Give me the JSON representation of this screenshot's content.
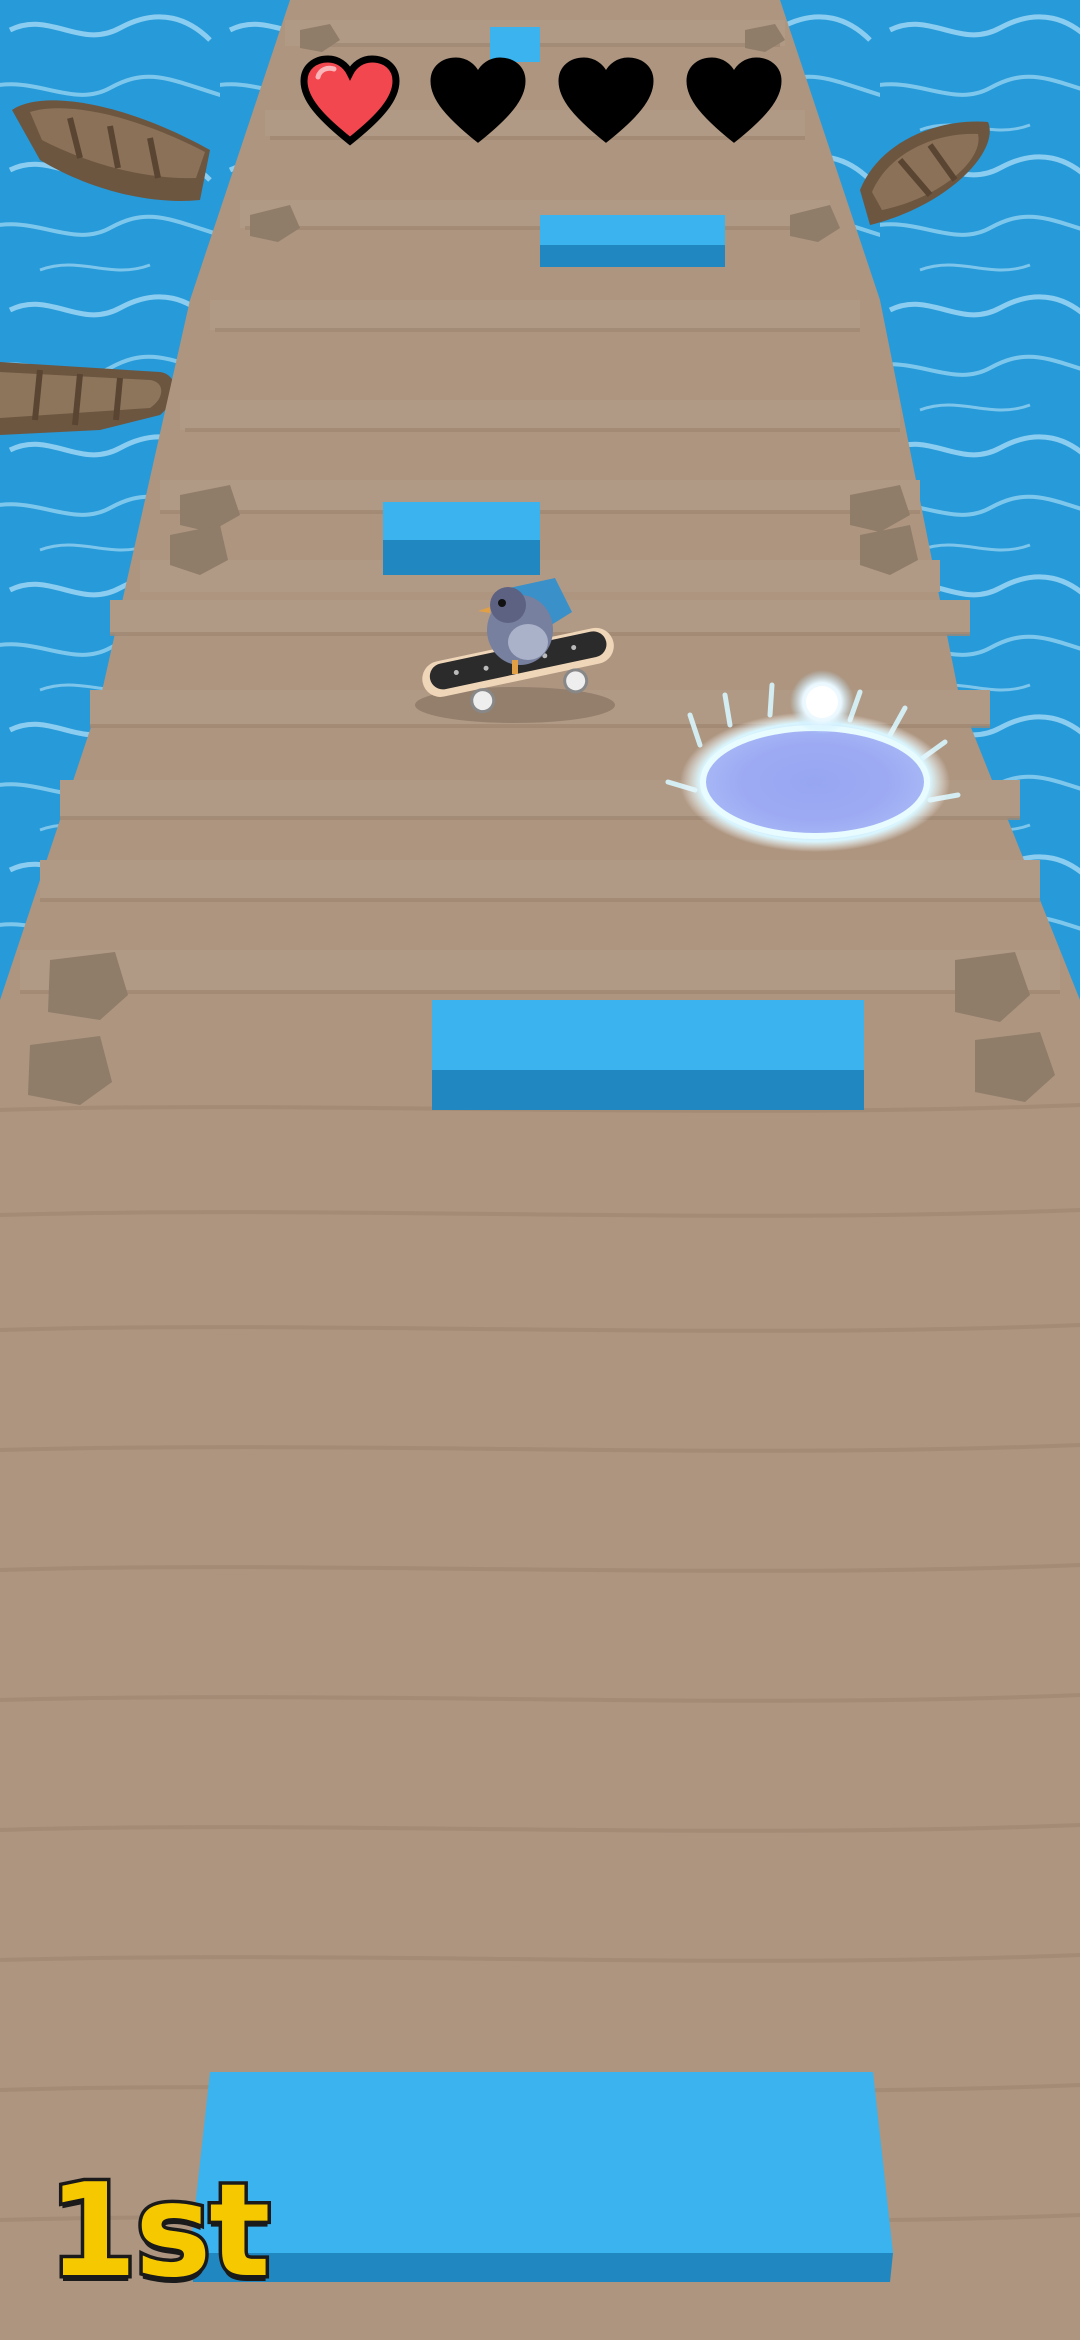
{
  "hud": {
    "lives": {
      "filled": 1,
      "total": 4,
      "filled_color": "#f2474f",
      "empty_color": "#000000",
      "icon": "heart-icon"
    },
    "rank_label": "1st",
    "rank_color": "#f6c800"
  },
  "scene": {
    "water_color": "#1e95d6",
    "pier_color": "#ad9580",
    "obstacle_color": "#3bb3ee",
    "character": "pigeon-on-skateboard",
    "pickup": "glowing-portal"
  }
}
